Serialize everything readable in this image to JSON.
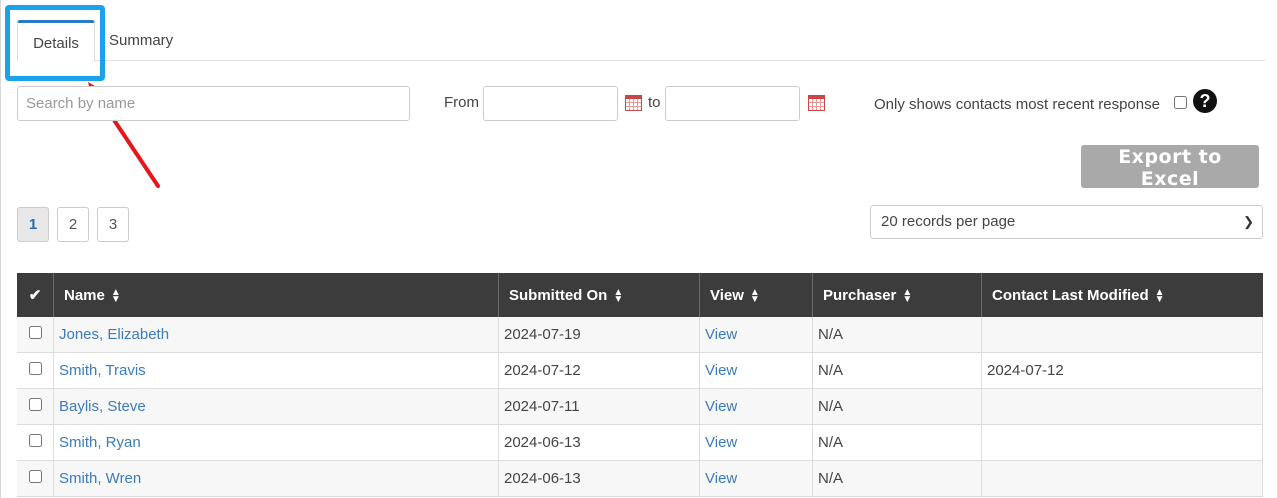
{
  "tabs": [
    {
      "label": "Details",
      "active": true
    },
    {
      "label": "Summary",
      "active": false
    }
  ],
  "filters": {
    "search_placeholder": "Search by name",
    "from_label": "From",
    "from_value": "",
    "to_label": "to",
    "to_value": "",
    "recent_label": "Only shows contacts most recent response",
    "recent_checked": false,
    "help_icon": "question-circle-icon"
  },
  "export_label": "Export to Excel",
  "pagination": {
    "pages": [
      "1",
      "2",
      "3"
    ],
    "current": "1",
    "per_page": "20 records per page"
  },
  "table": {
    "headers": {
      "select_icon": "✔",
      "name": "Name",
      "submitted": "Submitted On",
      "view": "View",
      "purchaser": "Purchaser",
      "modified": "Contact Last Modified"
    },
    "rows": [
      {
        "name": "Jones, Elizabeth",
        "submitted": "2024-07-19",
        "view": "View",
        "purchaser": "N/A",
        "modified": ""
      },
      {
        "name": "Smith, Travis",
        "submitted": "2024-07-12",
        "view": "View",
        "purchaser": "N/A",
        "modified": "2024-07-12"
      },
      {
        "name": "Baylis, Steve",
        "submitted": "2024-07-11",
        "view": "View",
        "purchaser": "N/A",
        "modified": ""
      },
      {
        "name": "Smith, Ryan",
        "submitted": "2024-06-13",
        "view": "View",
        "purchaser": "N/A",
        "modified": ""
      },
      {
        "name": "Smith, Wren",
        "submitted": "2024-06-13",
        "view": "View",
        "purchaser": "N/A",
        "modified": ""
      }
    ]
  },
  "colors": {
    "highlight": "#1aa3ec",
    "arrow": "#e8141c",
    "header_bg": "#3c3c3c",
    "link": "#3b7bbf"
  }
}
